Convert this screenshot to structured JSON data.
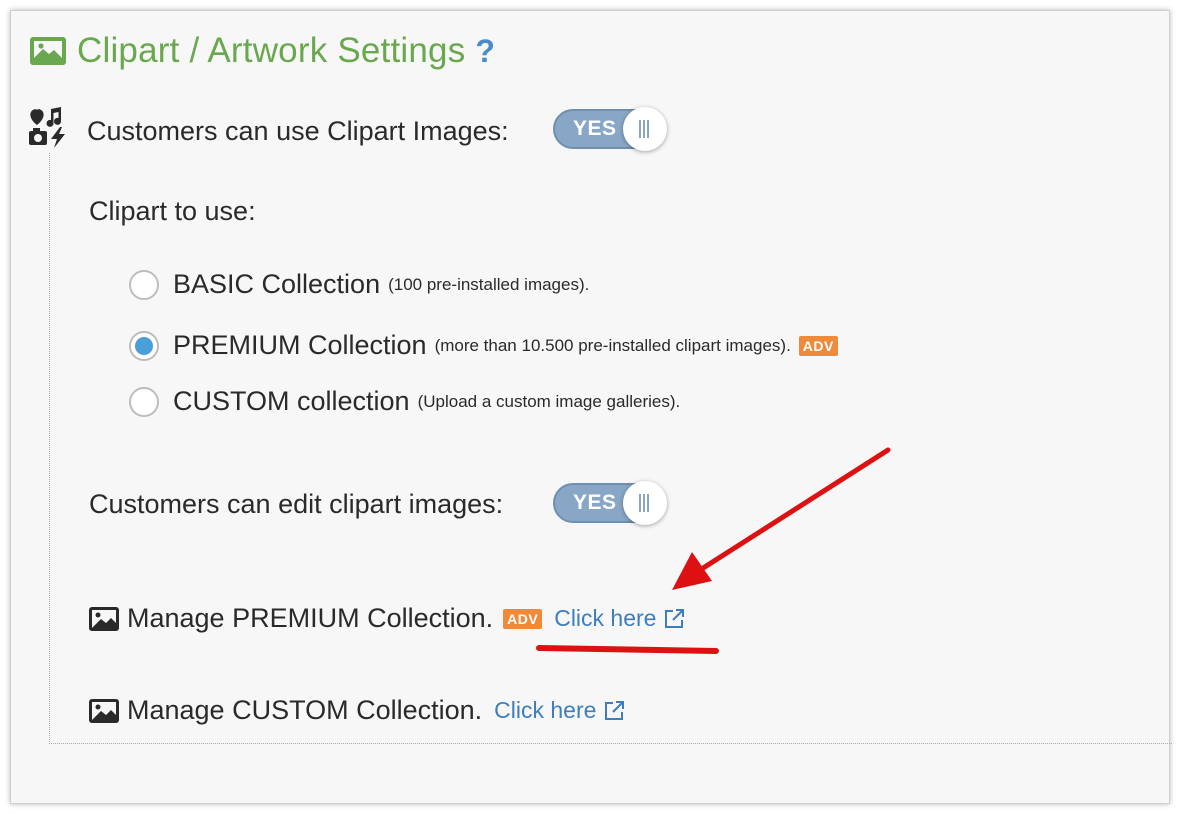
{
  "section": {
    "title": "Clipart / Artwork Settings",
    "help": "?"
  },
  "use_clipart": {
    "label": "Customers can use Clipart Images:",
    "toggle": "YES"
  },
  "clipart_to_use": {
    "label": "Clipart to use:",
    "options": [
      {
        "name": "BASIC Collection",
        "note": "(100 pre-installed images).",
        "selected": false
      },
      {
        "name": "PREMIUM Collection",
        "note": "(more than 10.500 pre-installed clipart images).",
        "selected": true,
        "badge": "ADV"
      },
      {
        "name": "CUSTOM collection",
        "note": "(Upload a custom image galleries).",
        "selected": false
      }
    ]
  },
  "edit_clipart": {
    "label": "Customers can edit clipart images:",
    "toggle": "YES"
  },
  "manage_premium": {
    "label": "Manage PREMIUM Collection.",
    "badge": "ADV",
    "link": "Click here"
  },
  "manage_custom": {
    "label": "Manage CUSTOM Collection.",
    "link": "Click here"
  },
  "colors": {
    "title_green": "#6aa84f",
    "link_blue": "#3d7ebd",
    "toggle_blue": "#88a7c6",
    "radio_selected": "#4a9fd8",
    "badge_orange": "#ee8a3a",
    "annotation_red": "#dd1111"
  }
}
